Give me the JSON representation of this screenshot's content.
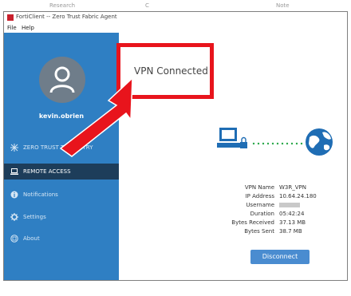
{
  "background_table": {
    "col1": "Research",
    "col2": "C",
    "col3": "Note"
  },
  "window": {
    "title": "FortiClient -- Zero Trust Fabric Agent",
    "menu": [
      "File",
      "Help"
    ]
  },
  "sidebar": {
    "username": "kevin.obrien",
    "items": [
      {
        "label": "ZERO TRUST TELEMETRY",
        "icon": "network-icon",
        "active": false
      },
      {
        "label": "REMOTE ACCESS",
        "icon": "laptop-icon",
        "active": true
      },
      {
        "label": "Notifications",
        "icon": "info-icon",
        "active": false
      },
      {
        "label": "Settings",
        "icon": "gear-icon",
        "active": false
      },
      {
        "label": "About",
        "icon": "about-icon",
        "active": false
      }
    ]
  },
  "main": {
    "status": "VPN Connected",
    "details": [
      {
        "label": "VPN Name",
        "value": "W3R_VPN"
      },
      {
        "label": "IP Address",
        "value": "10.64.24.180"
      },
      {
        "label": "Username",
        "value": ""
      },
      {
        "label": "Duration",
        "value": "05:42:24"
      },
      {
        "label": "Bytes Received",
        "value": "37.13 MB"
      },
      {
        "label": "Bytes Sent",
        "value": "38.7 MB"
      }
    ],
    "disconnect_label": "Disconnect"
  },
  "colors": {
    "sidebar": "#2f7fc3",
    "active_item": "#1d3d5a",
    "highlight_box": "#e8141c",
    "button": "#4a8cd0"
  }
}
